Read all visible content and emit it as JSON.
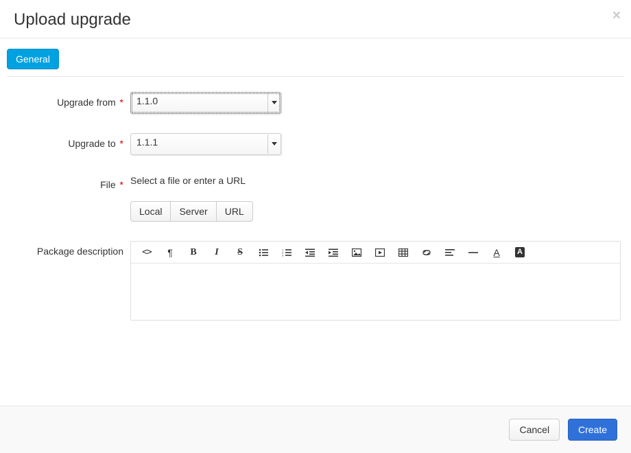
{
  "header": {
    "title": "Upload upgrade",
    "close_glyph": "×"
  },
  "tabs": {
    "general": "General"
  },
  "form": {
    "upgrade_from": {
      "label": "Upgrade from",
      "required": "*",
      "value": "1.1.0"
    },
    "upgrade_to": {
      "label": "Upgrade to",
      "required": "*",
      "value": "1.1.1"
    },
    "file": {
      "label": "File",
      "required": "*",
      "hint": "Select a file or enter a URL",
      "buttons": {
        "local": "Local",
        "server": "Server",
        "url": "URL"
      }
    },
    "description": {
      "label": "Package description"
    }
  },
  "editor": {
    "code": "<>",
    "paragraph": "¶",
    "bold": "B",
    "italic": "I",
    "strike": "S",
    "underline": "A",
    "bgcolor": "A"
  },
  "footer": {
    "cancel": "Cancel",
    "create": "Create"
  }
}
